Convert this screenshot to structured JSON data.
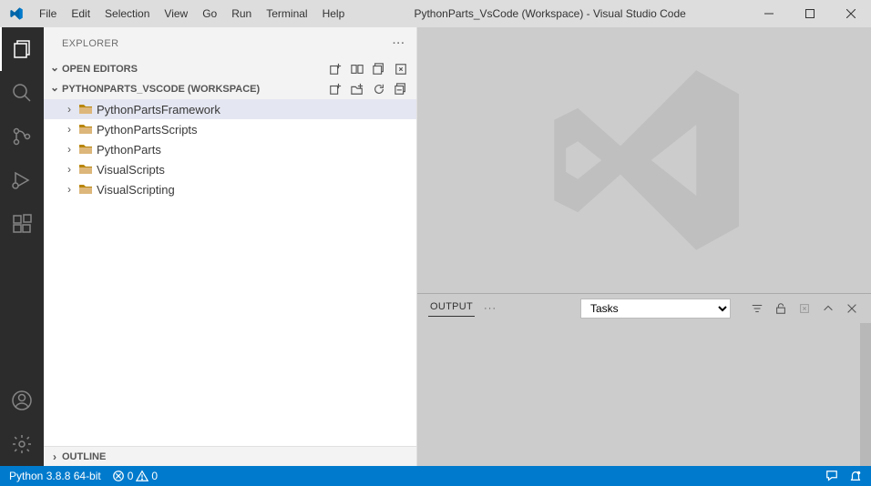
{
  "titlebar": {
    "menu": [
      "File",
      "Edit",
      "Selection",
      "View",
      "Go",
      "Run",
      "Terminal",
      "Help"
    ],
    "title": "PythonParts_VsCode (Workspace) - Visual Studio Code"
  },
  "sidebar": {
    "title": "EXPLORER",
    "sections": {
      "openEditors": "OPEN EDITORS",
      "workspace": "PYTHONPARTS_VSCODE (WORKSPACE)",
      "outline": "OUTLINE"
    },
    "tree": [
      "PythonPartsFramework",
      "PythonPartsScripts",
      "PythonParts",
      "VisualScripts",
      "VisualScripting"
    ]
  },
  "panel": {
    "tab": "OUTPUT",
    "dropdown": "Tasks"
  },
  "statusbar": {
    "python": "Python 3.8.8 64-bit",
    "errors": "0",
    "warnings": "0"
  }
}
